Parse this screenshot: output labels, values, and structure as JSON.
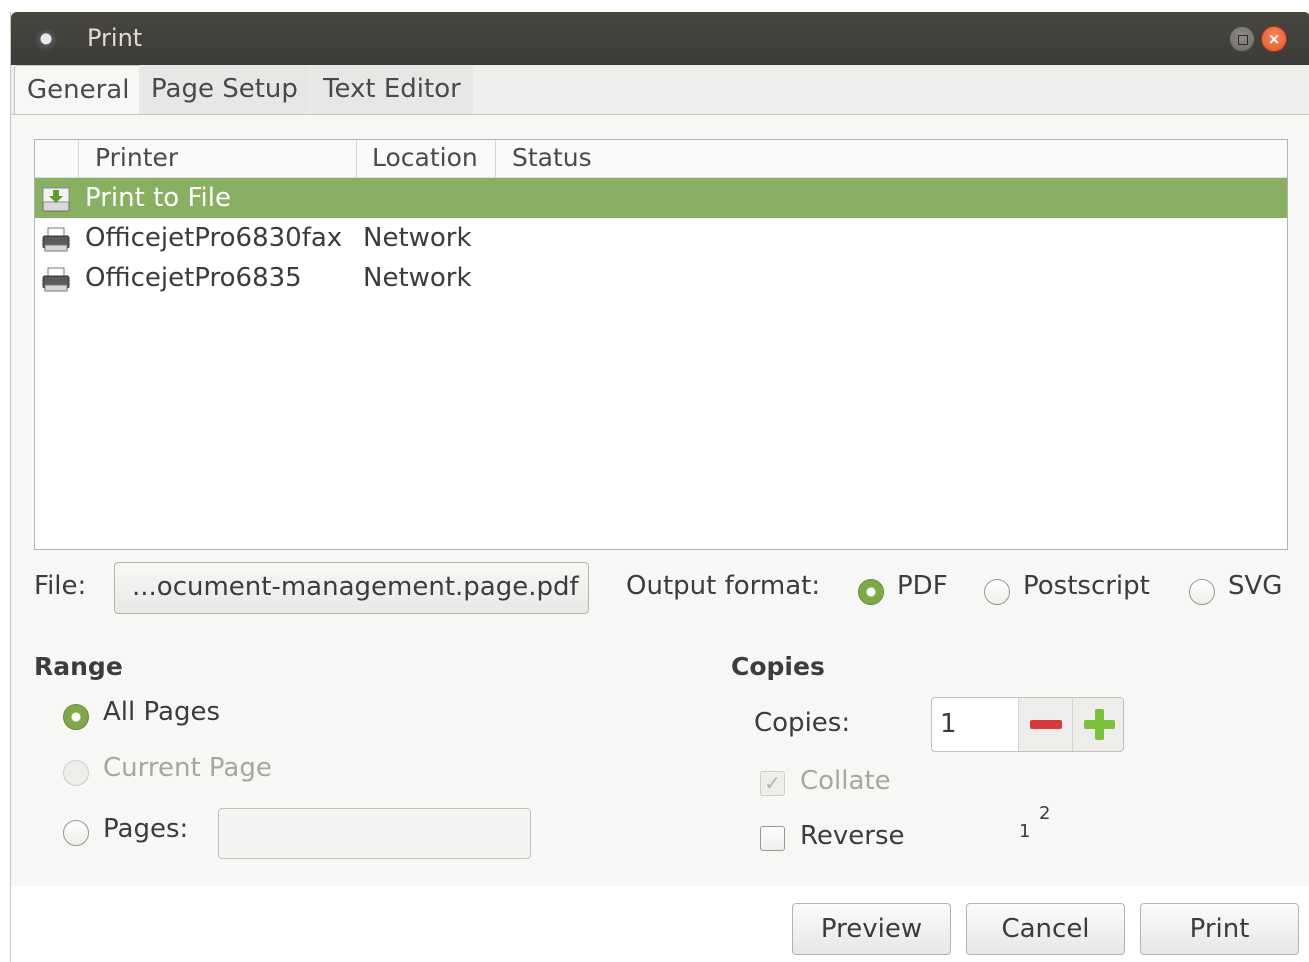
{
  "window": {
    "title": "Print"
  },
  "tabs": [
    {
      "label": "General",
      "active": true
    },
    {
      "label": "Page Setup",
      "active": false
    },
    {
      "label": "Text Editor",
      "active": false
    }
  ],
  "printer_list": {
    "columns": [
      "Printer",
      "Location",
      "Status"
    ],
    "rows": [
      {
        "icon": "print-to-file-icon",
        "name": "Print to File",
        "location": "",
        "status": "",
        "selected": true
      },
      {
        "icon": "printer-icon",
        "name": "OfficejetPro6830fax",
        "location": "Network",
        "status": "",
        "selected": false
      },
      {
        "icon": "printer-icon",
        "name": "OfficejetPro6835",
        "location": "Network",
        "status": "",
        "selected": false
      }
    ]
  },
  "file": {
    "label": "File:",
    "value": "...ocument-management.page.pdf"
  },
  "output_format": {
    "label": "Output format:",
    "options": [
      "PDF",
      "Postscript",
      "SVG"
    ],
    "selected": "PDF"
  },
  "range": {
    "title": "Range",
    "all_pages": "All Pages",
    "current_page": "Current Page",
    "pages": "Pages:",
    "pages_value": "",
    "selected": "All Pages"
  },
  "copies": {
    "title": "Copies",
    "label": "Copies:",
    "value": "1",
    "collate": "Collate",
    "collate_checked": true,
    "collate_disabled": true,
    "reverse": "Reverse",
    "reverse_checked": false,
    "diagram": [
      "1",
      "2"
    ]
  },
  "buttons": {
    "preview": "Preview",
    "cancel": "Cancel",
    "print": "Print"
  },
  "colors": {
    "selection": "#89b062",
    "titlebar": "#3c3b37",
    "close_button": "#e0562a"
  }
}
